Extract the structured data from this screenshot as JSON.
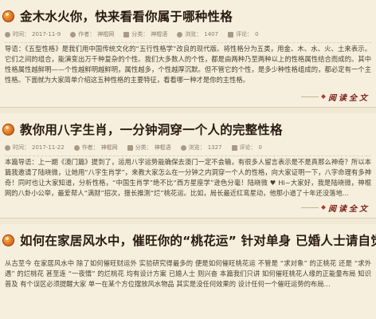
{
  "articles": [
    {
      "title": "金木水火你，快来看看你属于哪种性格",
      "meta": {
        "time_label": "时间：",
        "time": "2017-11-9",
        "author_label": "作者：",
        "author": "神棍网",
        "category_label": "分类：",
        "category": "神棍语",
        "views_label": "浏览：",
        "views": "1407",
        "comments_label": "评论：",
        "comments": "0"
      },
      "body": "导语：《五型性格》是我们用中国传统文化的“五行性格学”改良的现代版。将性格分为五类，用金、木、水、火、土来表示。它们之间的组合，能演变出万千种复杂的个性。我们大多数人的个性，都是由两种乃至两种以上的性格属性结合而成的。其中性格属性越鲜明——个性越鲜明越鲜明，属性越多，个性越厚沉默。但不管它的个性，是多少种性格组成的，都必定有一个主性格。下面就为大家简单介绍这五种性格的主要特征，看看哪一种才是你的主性格。",
      "more": "阅读全文"
    },
    {
      "title": "教你用八字生肖，一分钟洞穿一个人的完整性格",
      "meta": {
        "time_label": "时间：",
        "time": "2017-11-22",
        "author_label": "作者：",
        "author": "神棍网",
        "category_label": "分类：",
        "category": "神棍语",
        "views_label": "浏览：",
        "views": "1327",
        "comments_label": "评论：",
        "comments": "0"
      },
      "body": "本篇导语：上一期《澳门篇》提到了，运用八字运势能确保去澳门一定不会输，有很多人留言表示是不是真那么神奇？所以本篇我邀请了陆晓微，让她用“八字生肖学”，来教大家怎么在一分钟之内洞穿一个人的性格，向大家证明一下，八字命理有多神奇！同时也让大家知道，分析性格，“中国生肖学”绝不比“西方星座学”逊色分毫！陆晓微 ♥ Hi~大家好，我是陆晓微，神棍网的八卦小公举，最爱帮人“满财”招次，擅长推测“烂”桃花运。比如，局长最近红鸾星动，他那小道了十年还没落地…",
      "more": "阅读全文"
    },
    {
      "title": "如何在家居风水中，催旺你的“桃花运” 针对单身 已婚人士请自觉",
      "meta": {
        "time_label": "",
        "time": "",
        "author_label": "",
        "author": "",
        "category_label": "",
        "category": "",
        "views_label": "",
        "views": "",
        "comments_label": "",
        "comments": ""
      },
      "body": "从古至今 在家居风水中 除了如何催旺财运外 实验研究得最多的 便是如何催旺桃花运 不管是 “求对象” 的正桃花 还是 “求外遇” 的烂桃花 甚至连 “一夜情” 的烂桃花 均有设计方案 已婚人士 则兴奋 本篇我们只讲 如何催旺桃花人缘的正能量布局 知识普及 有个误区必须提醒大家 单一在某个方位摆放风水物品 其实是没任何效果的 设计任何一个催旺运势的布局…",
      "more": "阅读全文"
    }
  ]
}
